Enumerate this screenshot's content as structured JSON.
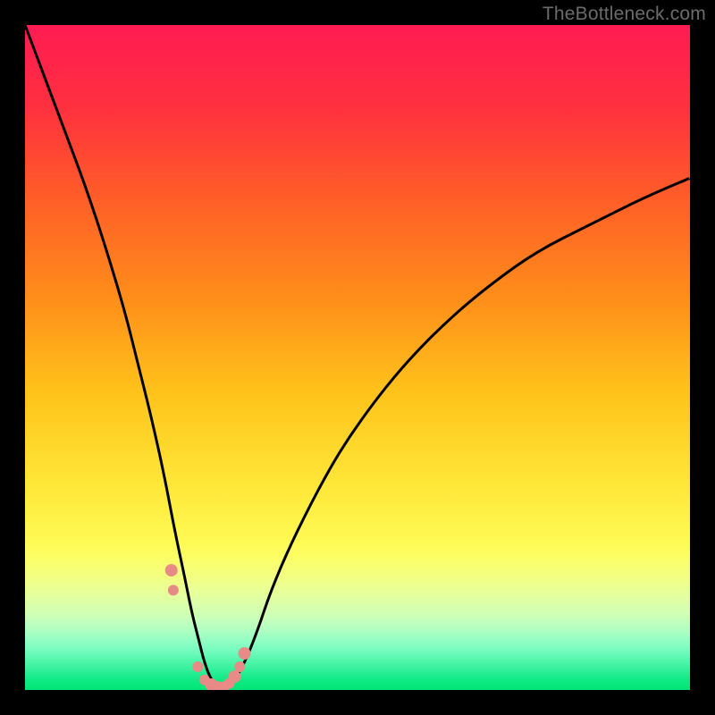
{
  "attribution": "TheBottleneck.com",
  "gradient": {
    "stops": [
      {
        "offset": 0.0,
        "color": "#ff1b53"
      },
      {
        "offset": 0.12,
        "color": "#ff2f3f"
      },
      {
        "offset": 0.25,
        "color": "#ff5a2a"
      },
      {
        "offset": 0.4,
        "color": "#ff8a1a"
      },
      {
        "offset": 0.55,
        "color": "#ffc21a"
      },
      {
        "offset": 0.7,
        "color": "#ffe93a"
      },
      {
        "offset": 0.78,
        "color": "#fffb55"
      },
      {
        "offset": 0.805,
        "color": "#fbff6a"
      },
      {
        "offset": 0.83,
        "color": "#f3ff82"
      },
      {
        "offset": 0.86,
        "color": "#e3ffa0"
      },
      {
        "offset": 0.89,
        "color": "#ccffb8"
      },
      {
        "offset": 0.915,
        "color": "#a7ffc4"
      },
      {
        "offset": 0.94,
        "color": "#76fcc0"
      },
      {
        "offset": 0.965,
        "color": "#3df2a0"
      },
      {
        "offset": 0.985,
        "color": "#10e985"
      },
      {
        "offset": 1.0,
        "color": "#00e676"
      }
    ]
  },
  "chart_data": {
    "type": "line",
    "title": "",
    "xlabel": "",
    "ylabel": "",
    "xlim": [
      0,
      100
    ],
    "ylim": [
      0,
      100
    ],
    "series": [
      {
        "name": "curve",
        "x": [
          0,
          3,
          6,
          9,
          12,
          15,
          17,
          19,
          21,
          22.5,
          24,
          25,
          26,
          27,
          28,
          29,
          30,
          31.5,
          33,
          35,
          37,
          40,
          44,
          48,
          53,
          58,
          64,
          70,
          77,
          85,
          93,
          100
        ],
        "values": [
          100,
          92,
          84,
          76,
          67,
          57,
          49,
          41,
          32,
          24,
          17,
          12,
          8,
          4,
          1.5,
          0.5,
          0.5,
          1.5,
          4,
          9,
          15,
          22,
          30,
          37,
          44,
          50,
          56,
          61,
          66,
          70,
          74,
          77
        ]
      }
    ],
    "scatter": {
      "name": "dots",
      "x": [
        22.0,
        22.3,
        26.0,
        27.0,
        28.0,
        29.0,
        30.0,
        30.7,
        31.5,
        32.3,
        33.0
      ],
      "values": [
        18.0,
        15.0,
        3.5,
        1.5,
        0.8,
        0.5,
        0.5,
        1.0,
        2.0,
        3.5,
        5.5
      ],
      "r": [
        7,
        6,
        6,
        6,
        7,
        6,
        6,
        6,
        7,
        6,
        7
      ]
    }
  }
}
